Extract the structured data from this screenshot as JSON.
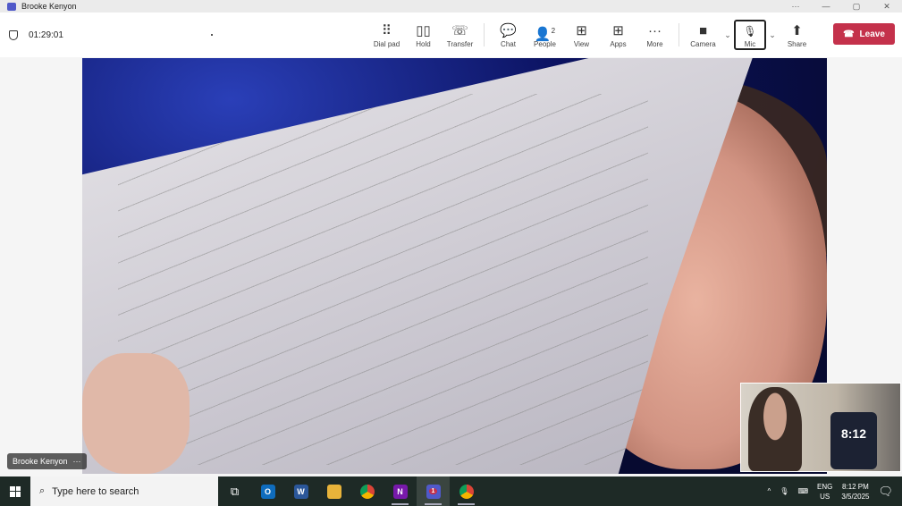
{
  "window": {
    "title": "Brooke Kenyon",
    "controls": [
      "···",
      "—",
      "▢",
      "✕"
    ]
  },
  "call": {
    "timer": "01:29:01"
  },
  "toolbar": {
    "tools": [
      {
        "label": "Dial pad",
        "icon": "⠿"
      },
      {
        "label": "Hold",
        "icon": "▯▯"
      },
      {
        "label": "Transfer",
        "icon": "☏"
      },
      {
        "label": "Chat",
        "icon": "💬"
      },
      {
        "label": "People",
        "icon": "👤",
        "count": "2"
      },
      {
        "label": "View",
        "icon": "⊞"
      },
      {
        "label": "Apps",
        "icon": "⊞"
      },
      {
        "label": "More",
        "icon": "···"
      },
      {
        "label": "Camera",
        "icon": "■"
      },
      {
        "label": "Mic",
        "icon": "🎙"
      },
      {
        "label": "Share",
        "icon": "⬆"
      }
    ],
    "leave": "Leave"
  },
  "video": {
    "participant": "Brooke Kenyon",
    "more": "···",
    "self_clock": "8:12"
  },
  "taskbar": {
    "search_placeholder": "Type here to search",
    "lang": "ENG",
    "region": "US",
    "time": "8:12 PM",
    "date": "3/5/2025",
    "teams_badge": "1"
  },
  "colors": {
    "leave": "#c4314b",
    "teams": "#5059c9"
  }
}
